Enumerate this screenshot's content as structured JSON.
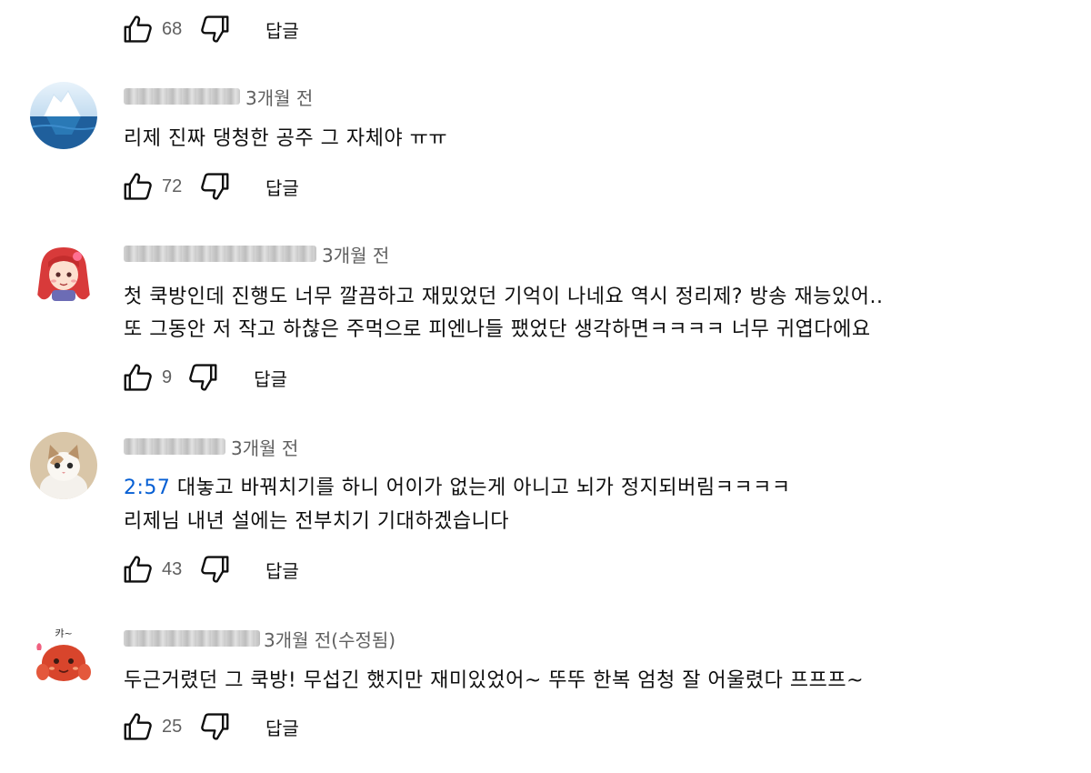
{
  "icons": {
    "like": "thumbs-up-icon",
    "dislike": "thumbs-down-icon"
  },
  "colors": {
    "text": "#0f0f0f",
    "secondary": "#606060",
    "link": "#065fd4"
  },
  "reply_label": "답글",
  "top_row": {
    "like_count": "68"
  },
  "comments": [
    {
      "time": "3개월 전",
      "lines": [
        "리제 진짜 댕청한 공주 그 자체야 ㅠㅠ"
      ],
      "like_count": "72"
    },
    {
      "time": "3개월 전",
      "lines": [
        "첫 쿡방인데 진행도 너무 깔끔하고 재밌었던 기억이 나네요 역시 정리제? 방송 재능있어..",
        "또 그동안 저 작고 하찮은 주먹으로 피엔나들 팼었단 생각하면ㅋㅋㅋㅋ 너무 귀엽다에요"
      ],
      "like_count": "9"
    },
    {
      "time": "3개월 전",
      "timestamp_link": "2:57",
      "lines": [
        " 대놓고 바꿔치기를 하니 어이가 없는게 아니고 뇌가 정지되버림ㅋㅋㅋㅋ",
        "리제님 내년 설에는 전부치기 기대하겠습니다"
      ],
      "like_count": "43"
    },
    {
      "time": "3개월 전(수정됨)",
      "avatar_text": "캬~",
      "lines": [
        "두근거렸던 그 쿡방! 무섭긴 했지만 재미있었어~ 뚜뚜 한복 엄청 잘 어울렸다 프프프~"
      ],
      "like_count": "25"
    }
  ]
}
